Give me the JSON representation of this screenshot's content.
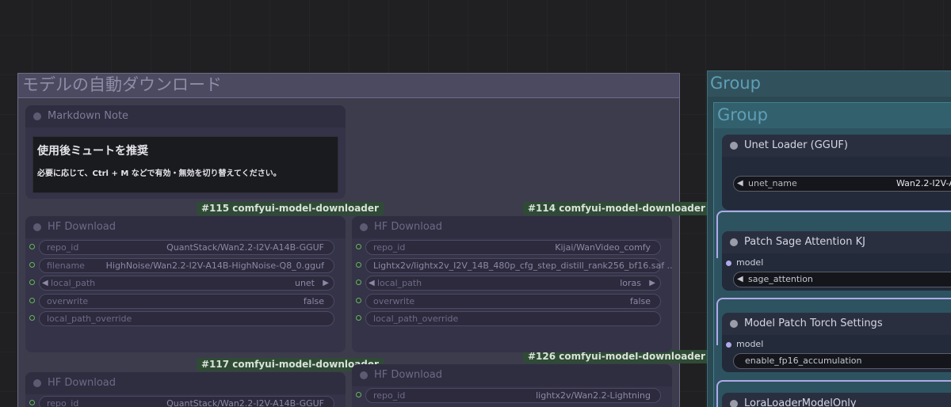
{
  "groups": {
    "jp_title": "モデルの自動ダウンロード",
    "outer_title": "Group",
    "inner_title": "Group"
  },
  "markdown_node": {
    "title": "Markdown Note",
    "heading": "使用後ミュートを推奨",
    "body": "必要に応じて、Ctrl + M などで有効・無効を切り替えてください。"
  },
  "badges": {
    "b115": "#115 comfyui-model-downloader",
    "b114": "#114 comfyui-model-downloader",
    "b117": "#117 comfyui-model-downloader",
    "b126": "#126 comfyui-model-downloader"
  },
  "hf_nodes": [
    {
      "title": "HF Download",
      "repo_id_label": "repo_id",
      "repo_id": "QuantStack/Wan2.2-I2V-A14B-GGUF",
      "filename_label": "filename",
      "filename": "HighNoise/Wan2.2-I2V-A14B-HighNoise-Q8_0.gguf",
      "local_path_label": "local_path",
      "local_path": "unet",
      "overwrite_label": "overwrite",
      "overwrite": "false",
      "override_label": "local_path_override"
    },
    {
      "title": "HF Download",
      "repo_id_label": "repo_id",
      "repo_id": "Kijai/WanVideo_comfy",
      "filename_label": "filename",
      "filename": "Lightx2v/lightx2v_I2V_14B_480p_cfg_step_distill_rank256_bf16.saf ...",
      "local_path_label": "local_path",
      "local_path": "loras",
      "overwrite_label": "overwrite",
      "overwrite": "false",
      "override_label": "local_path_override"
    },
    {
      "title": "HF Download",
      "repo_id_label": "repo_id",
      "repo_id": "QuantStack/Wan2.2-I2V-A14B-GGUF"
    },
    {
      "title": "HF Download",
      "repo_id_label": "repo_id",
      "repo_id": "lightx2v/Wan2.2-Lightning"
    }
  ],
  "right_nodes": {
    "unet_title": "Unet Loader (GGUF)",
    "unet_name_label": "unet_name",
    "unet_name_value": "Wan2.2-I2V-A",
    "sage_title": "Patch Sage Attention KJ",
    "sage_input": "model",
    "sage_widget": "sage_attention",
    "torch_title": "Model Patch Torch Settings",
    "torch_input": "model",
    "torch_widget": "enable_fp16_accumulation",
    "lora_title": "LoraLoaderModelOnly"
  },
  "icons": {
    "combo_left": "◀",
    "combo_right": "▶"
  },
  "colors": {
    "badge_bg": "#2f4b36",
    "group_jp": "#3d3c4d",
    "group_teal": "#2b4953",
    "link": "#b0a9e8"
  }
}
